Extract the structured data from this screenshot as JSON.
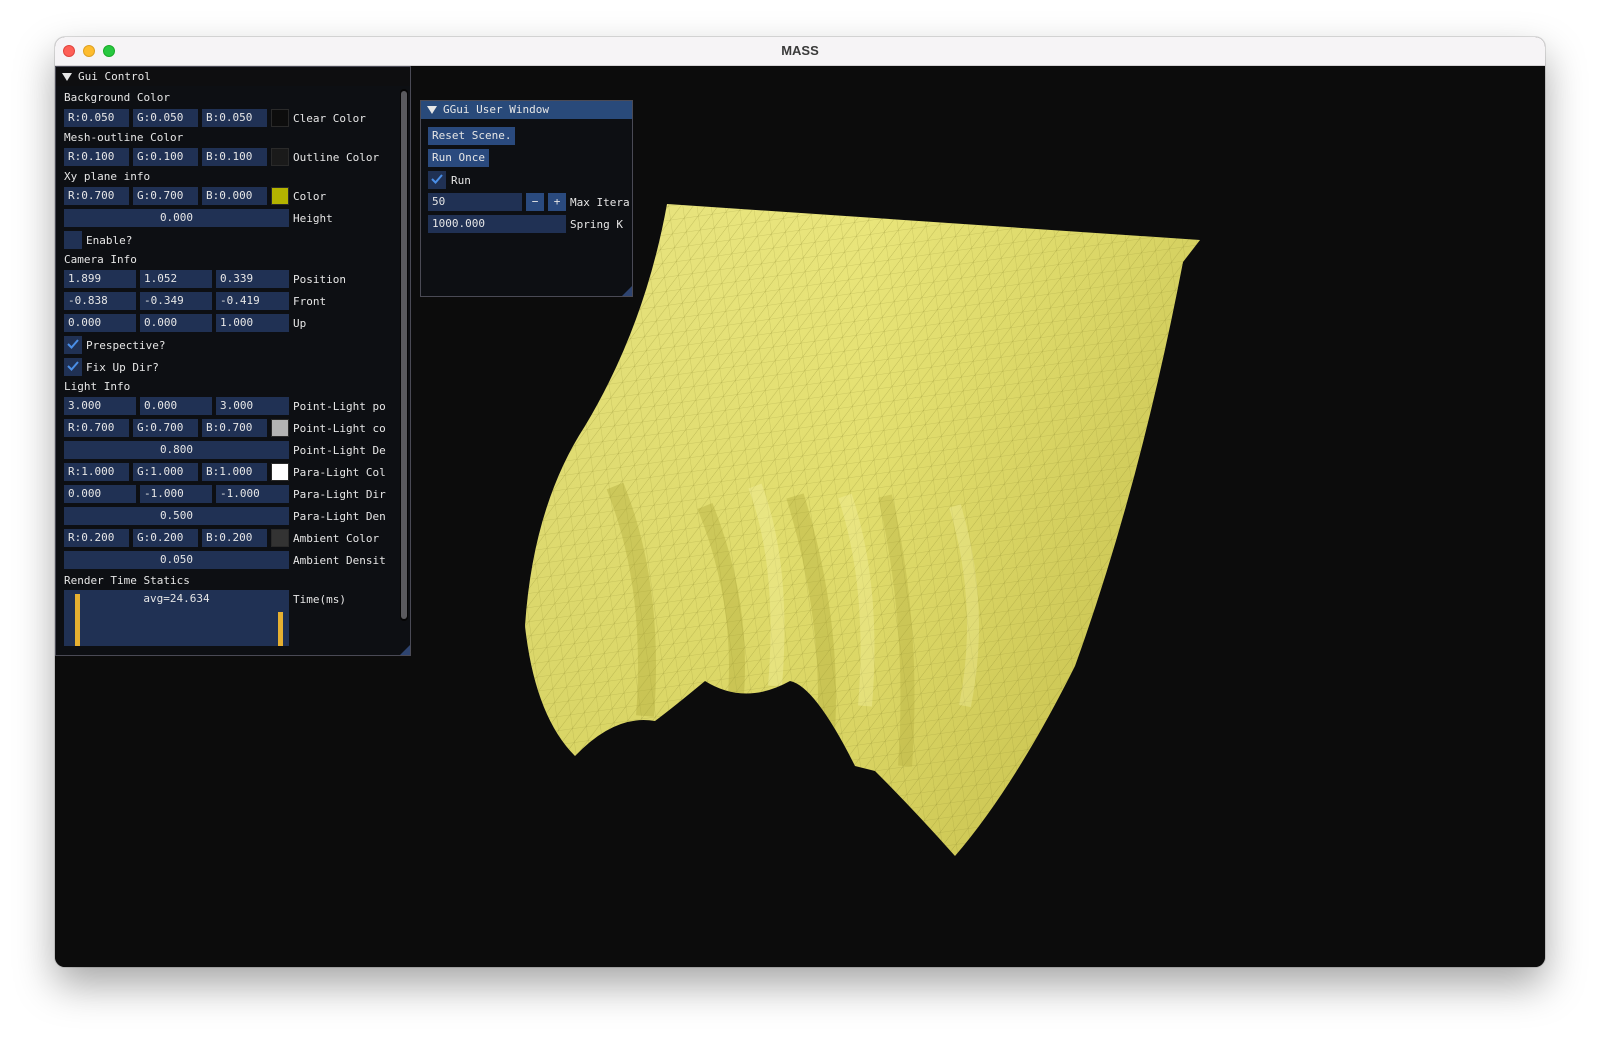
{
  "window": {
    "title": "MASS"
  },
  "gui_control": {
    "title": "Gui Control",
    "background_color": {
      "section": "Background Color",
      "r": "R:0.050",
      "g": "G:0.050",
      "b": "B:0.050",
      "label": "Clear Color",
      "swatch": "#0d0d0d"
    },
    "mesh_outline_color": {
      "section": "Mesh-outline Color",
      "r": "R:0.100",
      "g": "G:0.100",
      "b": "B:0.100",
      "label": "Outline Color",
      "swatch": "#1a1a1a"
    },
    "xy_plane": {
      "section": "Xy plane info",
      "r": "R:0.700",
      "g": "G:0.700",
      "b": "B:0.000",
      "color_label": "Color",
      "swatch": "#b3b300",
      "height_value": "0.000",
      "height_label": "Height",
      "enable_label": "Enable?",
      "enable_checked": false
    },
    "camera": {
      "section": "Camera Info",
      "position": [
        "1.899",
        "1.052",
        "0.339"
      ],
      "position_label": "Position",
      "front": [
        "-0.838",
        "-0.349",
        "-0.419"
      ],
      "front_label": "Front",
      "up": [
        "0.000",
        "0.000",
        "1.000"
      ],
      "up_label": "Up",
      "perspective_label": "Prespective?",
      "perspective_checked": true,
      "fixup_label": "Fix Up Dir?",
      "fixup_checked": true
    },
    "light": {
      "section": "Light Info",
      "point_pos": [
        "3.000",
        "0.000",
        "3.000"
      ],
      "point_pos_label": "Point-Light po",
      "point_col": [
        "R:0.700",
        "G:0.700",
        "B:0.700"
      ],
      "point_col_label": "Point-Light co",
      "point_swatch": "#b3b3b3",
      "point_density": "0.800",
      "point_density_label": "Point-Light De",
      "para_col": [
        "R:1.000",
        "G:1.000",
        "B:1.000"
      ],
      "para_col_label": "Para-Light Col",
      "para_swatch": "#ffffff",
      "para_dir": [
        "0.000",
        "-1.000",
        "-1.000"
      ],
      "para_dir_label": "Para-Light Dir",
      "para_density": "0.500",
      "para_density_label": "Para-Light Den",
      "ambient_col": [
        "R:0.200",
        "G:0.200",
        "B:0.200"
      ],
      "ambient_col_label": "Ambient Color",
      "ambient_swatch": "#333333",
      "ambient_density": "0.050",
      "ambient_density_label": "Ambient Densit"
    },
    "render_time": {
      "section": "Render Time Statics",
      "avg": "avg=24.634",
      "label": "Time(ms)"
    }
  },
  "ggui_window": {
    "title": "GGui User Window",
    "reset_button": "Reset Scene.",
    "run_once_button": "Run Once",
    "run_label": "Run",
    "run_checked": true,
    "max_iter_value": "50",
    "minus": "−",
    "plus": "+",
    "max_iter_label": "Max Itera",
    "spring_k_value": "1000.000",
    "spring_k_label": "Spring K"
  },
  "colors": {
    "accent": "#4a8ee6",
    "field_bg": "#203154",
    "button_bg": "#2a4a7e",
    "cloth": "#e8e47a",
    "bar": "#e6b031"
  }
}
